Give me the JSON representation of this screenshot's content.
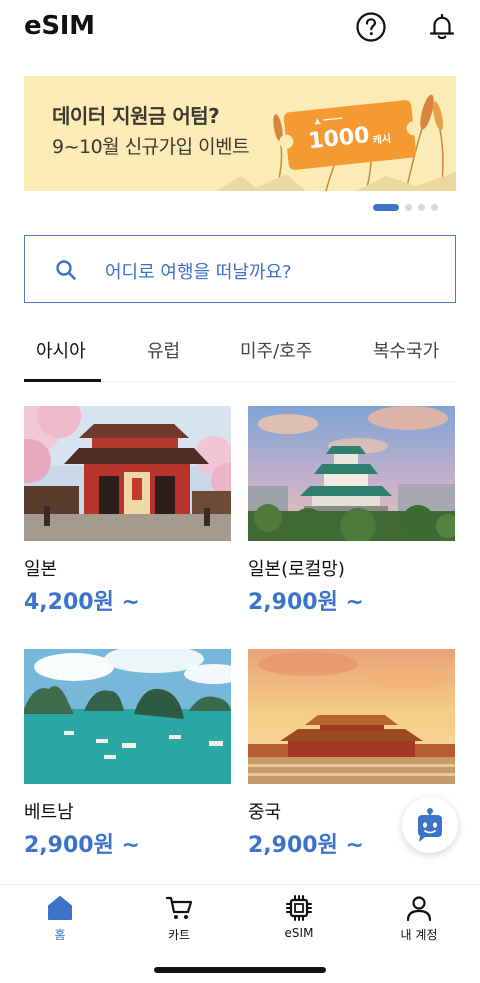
{
  "header": {
    "title": "eSIM",
    "help_icon": "question-circle-icon",
    "notification_icon": "bell-icon"
  },
  "banner": {
    "line1": "데이터 지원금 어텀?",
    "line2": "9~10월 신규가입 이벤트",
    "ticket_amount": "1000",
    "ticket_unit": "캐시",
    "slide_count": 4,
    "active_slide": 1
  },
  "search": {
    "placeholder": "어디로 여행을 떠날까요?"
  },
  "tabs": [
    {
      "label": "아시아",
      "active": true
    },
    {
      "label": "유럽",
      "active": false
    },
    {
      "label": "미주/호주",
      "active": false
    },
    {
      "label": "복수국가",
      "active": false
    }
  ],
  "products": [
    {
      "name": "일본",
      "price": "4,200원 ~"
    },
    {
      "name": "일본(로컬망)",
      "price": "2,900원 ~"
    },
    {
      "name": "베트남",
      "price": "2,900원 ~"
    },
    {
      "name": "중국",
      "price": "2,900원 ~"
    }
  ],
  "bottom_nav": [
    {
      "label": "홈",
      "icon": "home-icon",
      "active": true
    },
    {
      "label": "카트",
      "icon": "cart-icon",
      "active": false
    },
    {
      "label": "eSIM",
      "icon": "chip-icon",
      "active": false
    },
    {
      "label": "내 계정",
      "icon": "user-icon",
      "active": false
    }
  ],
  "colors": {
    "accent": "#3d73c9",
    "banner_bg": "#fbecb5",
    "ticket": "#f59a33"
  }
}
